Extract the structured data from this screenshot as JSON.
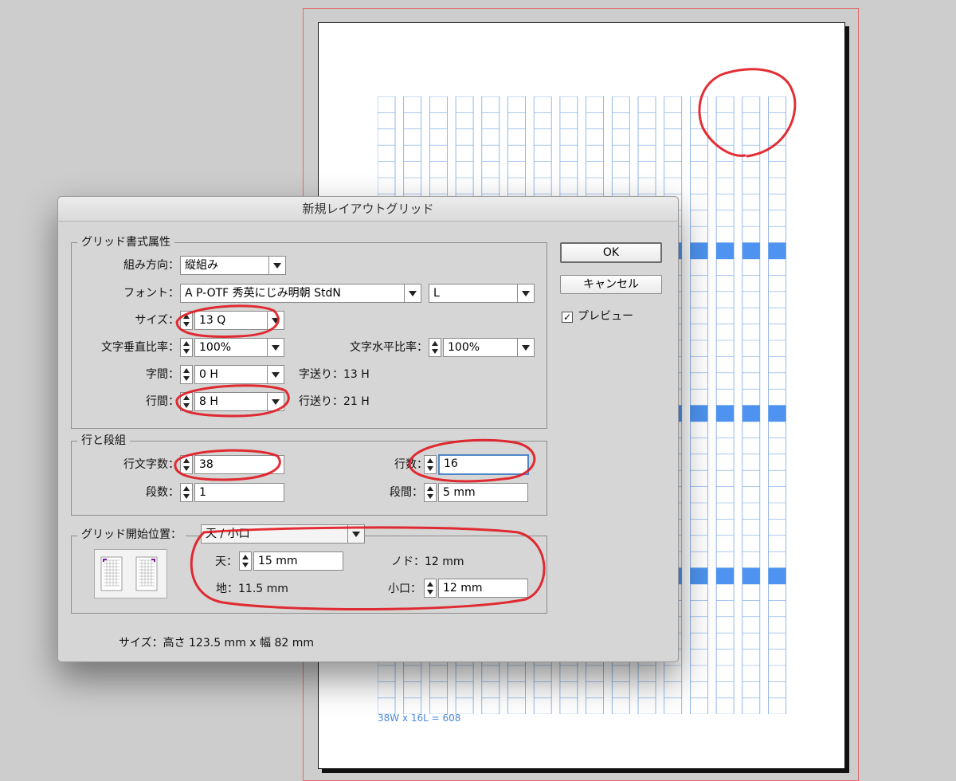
{
  "dialog_title": "新規レイアウトグリッド",
  "grid_group": {
    "legend": "グリッド書式属性",
    "direction_label": "組み方向：",
    "direction_value": "縦組み",
    "font_label": "フォント：",
    "font_value": "A P-OTF 秀英にじみ明朝 StdN",
    "font_style_value": "L",
    "size_label": "サイズ：",
    "size_value": "13 Q",
    "vscale_label": "文字垂直比率：",
    "vscale_value": "100%",
    "hscale_label": "文字水平比率：",
    "hscale_value": "100%",
    "char_space_label": "字間：",
    "char_space_value": "0 H",
    "char_advance": "字送り：13 H",
    "line_space_label": "行間：",
    "line_space_value": "8 H",
    "line_advance": "行送り：21 H"
  },
  "columns_group": {
    "legend": "行と段組",
    "chars_per_line_label": "行文字数：",
    "chars_per_line_value": "38",
    "lines_label": "行数：",
    "lines_value": "16",
    "columns_label": "段数：",
    "columns_value": "1",
    "gutter_label": "段間：",
    "gutter_value": "5 mm"
  },
  "start_group": {
    "legend": "グリッド開始位置：",
    "start_value": "天 / 小口",
    "top_label": "天：",
    "top_value": "15 mm",
    "gutter_side": "ノド：12 mm",
    "bottom": "地：11.5 mm",
    "fore_edge_label": "小口：",
    "fore_edge_value": "12 mm"
  },
  "size_summary": "サイズ：高さ 123.5 mm x 幅 82 mm",
  "buttons": {
    "ok": "OK",
    "cancel": "キャンセル",
    "preview": "プレビュー"
  },
  "preview_checked": true,
  "grid_caption": "38W x 16L = 608",
  "colors": {
    "grid_line": "#7aa8e6",
    "grid_highlight": "#4e93ef",
    "annotation": "#e0171f"
  }
}
